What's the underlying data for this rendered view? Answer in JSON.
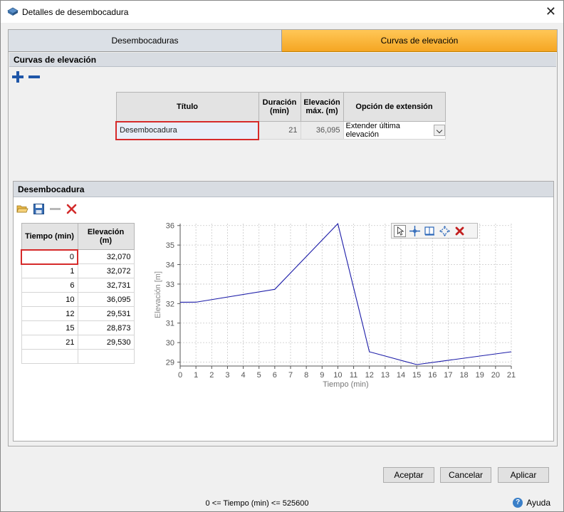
{
  "window": {
    "title": "Detalles de desembocadura",
    "close_glyph": "✕"
  },
  "tabs": [
    {
      "label": "Desembocaduras",
      "active": false
    },
    {
      "label": "Curvas de elevación",
      "active": true
    }
  ],
  "curves_section": {
    "header": "Curvas de elevación",
    "columns": [
      "Título",
      "Duración (min)",
      "Elevación máx. (m)",
      "Opción de extensión"
    ],
    "rows": [
      {
        "title": "Desembocadura",
        "duration": "21",
        "max_elev": "36,095",
        "extension": "Extender última elevación"
      }
    ]
  },
  "detail_section": {
    "header": "Desembocadura",
    "columns": [
      "Tiempo (min)",
      "Elevación (m)"
    ],
    "rows": [
      {
        "t": "0",
        "e": "32,070"
      },
      {
        "t": "1",
        "e": "32,072"
      },
      {
        "t": "6",
        "e": "32,731"
      },
      {
        "t": "10",
        "e": "36,095"
      },
      {
        "t": "12",
        "e": "29,531"
      },
      {
        "t": "15",
        "e": "28,873"
      },
      {
        "t": "21",
        "e": "29,530"
      }
    ]
  },
  "chart_data": {
    "type": "line",
    "xlabel": "Tiempo (min)",
    "ylabel": "Elevación [m]",
    "xlim": [
      0,
      21
    ],
    "ylim": [
      28.8,
      36.1
    ],
    "x_ticks": [
      0,
      1,
      2,
      3,
      4,
      5,
      6,
      7,
      8,
      9,
      10,
      11,
      12,
      13,
      14,
      15,
      16,
      17,
      18,
      19,
      20,
      21
    ],
    "y_ticks": [
      29,
      30,
      31,
      32,
      33,
      34,
      35,
      36
    ],
    "grid": true,
    "color": "#1c1ca8",
    "series": [
      {
        "x": [
          0,
          1,
          6,
          10,
          12,
          15,
          21
        ],
        "y": [
          32.07,
          32.072,
          32.731,
          36.095,
          29.531,
          28.873,
          29.53
        ]
      }
    ]
  },
  "buttons": {
    "accept": "Aceptar",
    "cancel": "Cancelar",
    "apply": "Aplicar"
  },
  "status": "0 <= Tiempo (min) <= 525600",
  "help": {
    "label": "Ayuda",
    "glyph": "?"
  }
}
